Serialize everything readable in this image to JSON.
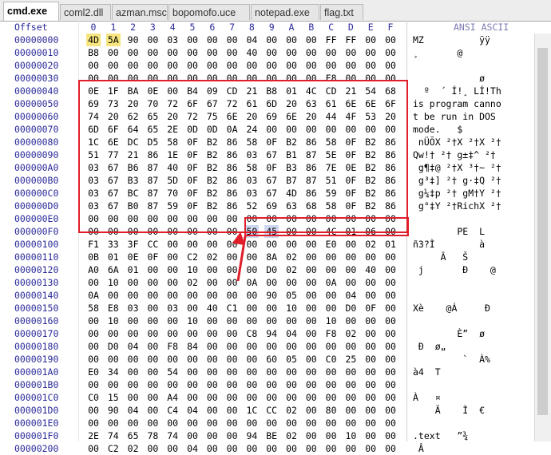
{
  "tabs": [
    {
      "label": "cmd.exe",
      "active": true
    },
    {
      "label": "coml2.dll",
      "active": false
    },
    {
      "label": "azman.msc",
      "active": false
    },
    {
      "label": "bopomofo.uce",
      "active": false
    },
    {
      "label": "notepad.exe",
      "active": false
    },
    {
      "label": "flag.txt",
      "active": false
    }
  ],
  "header": {
    "offset_label": "Offset",
    "columns": [
      "0",
      "1",
      "2",
      "3",
      "4",
      "5",
      "6",
      "7",
      "8",
      "9",
      "A",
      "B",
      "C",
      "D",
      "E",
      "F"
    ],
    "ascii_label": "ANSI ASCII"
  },
  "rows": [
    {
      "off": "00000000",
      "hex": [
        "4D",
        "5A",
        "90",
        "00",
        "03",
        "00",
        "00",
        "00",
        "04",
        "00",
        "00",
        "00",
        "FF",
        "FF",
        "00",
        "00"
      ],
      "asc": "MZ          ÿÿ  "
    },
    {
      "off": "00000010",
      "hex": [
        "B8",
        "00",
        "00",
        "00",
        "00",
        "00",
        "00",
        "00",
        "40",
        "00",
        "00",
        "00",
        "00",
        "00",
        "00",
        "00"
      ],
      "asc": "¸       @       "
    },
    {
      "off": "00000020",
      "hex": [
        "00",
        "00",
        "00",
        "00",
        "00",
        "00",
        "00",
        "00",
        "00",
        "00",
        "00",
        "00",
        "00",
        "00",
        "00",
        "00"
      ],
      "asc": "                "
    },
    {
      "off": "00000030",
      "hex": [
        "00",
        "00",
        "00",
        "00",
        "00",
        "00",
        "00",
        "00",
        "00",
        "00",
        "00",
        "00",
        "F8",
        "00",
        "00",
        "00"
      ],
      "asc": "            ø   "
    },
    {
      "off": "00000040",
      "hex": [
        "0E",
        "1F",
        "BA",
        "0E",
        "00",
        "B4",
        "09",
        "CD",
        "21",
        "B8",
        "01",
        "4C",
        "CD",
        "21",
        "54",
        "68"
      ],
      "asc": "  º  ´ Í!¸ LÍ!Th"
    },
    {
      "off": "00000050",
      "hex": [
        "69",
        "73",
        "20",
        "70",
        "72",
        "6F",
        "67",
        "72",
        "61",
        "6D",
        "20",
        "63",
        "61",
        "6E",
        "6E",
        "6F"
      ],
      "asc": "is program canno"
    },
    {
      "off": "00000060",
      "hex": [
        "74",
        "20",
        "62",
        "65",
        "20",
        "72",
        "75",
        "6E",
        "20",
        "69",
        "6E",
        "20",
        "44",
        "4F",
        "53",
        "20"
      ],
      "asc": "t be run in DOS "
    },
    {
      "off": "00000070",
      "hex": [
        "6D",
        "6F",
        "64",
        "65",
        "2E",
        "0D",
        "0D",
        "0A",
        "24",
        "00",
        "00",
        "00",
        "00",
        "00",
        "00",
        "00"
      ],
      "asc": "mode.   $       "
    },
    {
      "off": "00000080",
      "hex": [
        "1C",
        "6E",
        "DC",
        "D5",
        "58",
        "0F",
        "B2",
        "86",
        "58",
        "0F",
        "B2",
        "86",
        "58",
        "0F",
        "B2",
        "86"
      ],
      "asc": " nÜÕX ²†X ²†X ²†"
    },
    {
      "off": "00000090",
      "hex": [
        "51",
        "77",
        "21",
        "86",
        "1E",
        "0F",
        "B2",
        "86",
        "03",
        "67",
        "B1",
        "87",
        "5E",
        "0F",
        "B2",
        "86"
      ],
      "asc": "Qw!† ²† g±‡^ ²†"
    },
    {
      "off": "000000A0",
      "hex": [
        "03",
        "67",
        "B6",
        "87",
        "40",
        "0F",
        "B2",
        "86",
        "58",
        "0F",
        "B3",
        "86",
        "7E",
        "0E",
        "B2",
        "86"
      ],
      "asc": " g¶‡@ ²†X ³†~ ²†"
    },
    {
      "off": "000000B0",
      "hex": [
        "03",
        "67",
        "B3",
        "87",
        "5D",
        "0F",
        "B2",
        "86",
        "03",
        "67",
        "B7",
        "87",
        "51",
        "0F",
        "B2",
        "86"
      ],
      "asc": " g³‡] ²† g·‡Q ²†"
    },
    {
      "off": "000000C0",
      "hex": [
        "03",
        "67",
        "BC",
        "87",
        "70",
        "0F",
        "B2",
        "86",
        "03",
        "67",
        "4D",
        "86",
        "59",
        "0F",
        "B2",
        "86"
      ],
      "asc": " g¼‡p ²† gM†Y ²†"
    },
    {
      "off": "000000D0",
      "hex": [
        "03",
        "67",
        "B0",
        "87",
        "59",
        "0F",
        "B2",
        "86",
        "52",
        "69",
        "63",
        "68",
        "58",
        "0F",
        "B2",
        "86"
      ],
      "asc": " g°‡Y ²†RichX ²†"
    },
    {
      "off": "000000E0",
      "hex": [
        "00",
        "00",
        "00",
        "00",
        "00",
        "00",
        "00",
        "00",
        "00",
        "00",
        "00",
        "00",
        "00",
        "00",
        "00",
        "00"
      ],
      "asc": "                "
    },
    {
      "off": "000000F0",
      "hex": [
        "00",
        "00",
        "00",
        "00",
        "00",
        "00",
        "00",
        "00",
        "50",
        "45",
        "00",
        "00",
        "4C",
        "01",
        "06",
        "00"
      ],
      "asc": "        PE  L   "
    },
    {
      "off": "00000100",
      "hex": [
        "F1",
        "33",
        "3F",
        "CC",
        "00",
        "00",
        "00",
        "00",
        "00",
        "00",
        "00",
        "00",
        "E0",
        "00",
        "02",
        "01"
      ],
      "asc": "ñ3?Ì        à   "
    },
    {
      "off": "00000110",
      "hex": [
        "0B",
        "01",
        "0E",
        "0F",
        "00",
        "C2",
        "02",
        "00",
        "00",
        "8A",
        "02",
        "00",
        "00",
        "00",
        "00",
        "00"
      ],
      "asc": "     Â   Š      "
    },
    {
      "off": "00000120",
      "hex": [
        "A0",
        "6A",
        "01",
        "00",
        "00",
        "10",
        "00",
        "00",
        "00",
        "D0",
        "02",
        "00",
        "00",
        "00",
        "40",
        "00"
      ],
      "asc": " j       Ð    @ "
    },
    {
      "off": "00000130",
      "hex": [
        "00",
        "10",
        "00",
        "00",
        "00",
        "02",
        "00",
        "00",
        "0A",
        "00",
        "00",
        "00",
        "0A",
        "00",
        "00",
        "00"
      ],
      "asc": "                "
    },
    {
      "off": "00000140",
      "hex": [
        "0A",
        "00",
        "00",
        "00",
        "00",
        "00",
        "00",
        "00",
        "00",
        "90",
        "05",
        "00",
        "00",
        "04",
        "00",
        "00"
      ],
      "asc": "                "
    },
    {
      "off": "00000150",
      "hex": [
        "58",
        "E8",
        "03",
        "00",
        "03",
        "00",
        "40",
        "C1",
        "00",
        "00",
        "10",
        "00",
        "00",
        "D0",
        "0F",
        "00"
      ],
      "asc": "Xè    @Á     Ð  "
    },
    {
      "off": "00000160",
      "hex": [
        "00",
        "10",
        "00",
        "00",
        "00",
        "10",
        "00",
        "00",
        "00",
        "00",
        "00",
        "00",
        "10",
        "00",
        "00",
        "00"
      ],
      "asc": "                "
    },
    {
      "off": "00000170",
      "hex": [
        "00",
        "00",
        "00",
        "00",
        "00",
        "00",
        "00",
        "00",
        "C8",
        "94",
        "04",
        "00",
        "F8",
        "02",
        "00",
        "00"
      ],
      "asc": "        È”  ø   "
    },
    {
      "off": "00000180",
      "hex": [
        "00",
        "D0",
        "04",
        "00",
        "F8",
        "84",
        "00",
        "00",
        "00",
        "00",
        "00",
        "00",
        "00",
        "00",
        "00",
        "00"
      ],
      "asc": " Ð  ø„          "
    },
    {
      "off": "00000190",
      "hex": [
        "00",
        "00",
        "00",
        "00",
        "00",
        "00",
        "00",
        "00",
        "00",
        "60",
        "05",
        "00",
        "C0",
        "25",
        "00",
        "00"
      ],
      "asc": "         `  À%  "
    },
    {
      "off": "000001A0",
      "hex": [
        "E0",
        "34",
        "00",
        "00",
        "54",
        "00",
        "00",
        "00",
        "00",
        "00",
        "00",
        "00",
        "00",
        "00",
        "00",
        "00"
      ],
      "asc": "à4  T           "
    },
    {
      "off": "000001B0",
      "hex": [
        "00",
        "00",
        "00",
        "00",
        "00",
        "00",
        "00",
        "00",
        "00",
        "00",
        "00",
        "00",
        "00",
        "00",
        "00",
        "00"
      ],
      "asc": "                "
    },
    {
      "off": "000001C0",
      "hex": [
        "C0",
        "15",
        "00",
        "00",
        "A4",
        "00",
        "00",
        "00",
        "00",
        "00",
        "00",
        "00",
        "00",
        "00",
        "00",
        "00"
      ],
      "asc": "À   ¤           "
    },
    {
      "off": "000001D0",
      "hex": [
        "00",
        "90",
        "04",
        "00",
        "C4",
        "04",
        "00",
        "00",
        "1C",
        "CC",
        "02",
        "00",
        "80",
        "00",
        "00",
        "00"
      ],
      "asc": "    Ä    Ì  €   "
    },
    {
      "off": "000001E0",
      "hex": [
        "00",
        "00",
        "00",
        "00",
        "00",
        "00",
        "00",
        "00",
        "00",
        "00",
        "00",
        "00",
        "00",
        "00",
        "00",
        "00"
      ],
      "asc": "                "
    },
    {
      "off": "000001F0",
      "hex": [
        "2E",
        "74",
        "65",
        "78",
        "74",
        "00",
        "00",
        "00",
        "94",
        "BE",
        "02",
        "00",
        "00",
        "10",
        "00",
        "00"
      ],
      "asc": ".text   ”¾      "
    },
    {
      "off": "00000200",
      "hex": [
        "00",
        "C2",
        "02",
        "00",
        "00",
        "04",
        "00",
        "00",
        "00",
        "00",
        "00",
        "00",
        "00",
        "00",
        "00",
        "00"
      ],
      "asc": " Â              "
    }
  ],
  "colors": {
    "outline_red": "#e01e2a",
    "mz_highlight": "#f6e57f",
    "pe_highlight": "#cdd8f0",
    "offset_blue": "#2a2a9a"
  }
}
